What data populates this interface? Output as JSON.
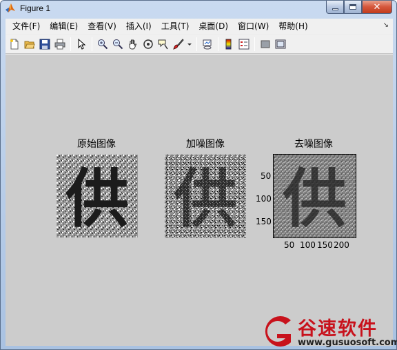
{
  "window": {
    "title": "Figure 1",
    "minimize_icon": "minimize-icon",
    "maximize_icon": "maximize-icon",
    "close_icon": "close-icon"
  },
  "menubar": {
    "items": [
      {
        "label": "文件(F)"
      },
      {
        "label": "编辑(E)"
      },
      {
        "label": "查看(V)"
      },
      {
        "label": "插入(I)"
      },
      {
        "label": "工具(T)"
      },
      {
        "label": "桌面(D)"
      },
      {
        "label": "窗口(W)"
      },
      {
        "label": "帮助(H)"
      }
    ],
    "overflow_icon": "dock-arrow-icon"
  },
  "toolbar": {
    "icons": [
      "new-figure-icon",
      "open-file-icon",
      "save-icon",
      "print-icon",
      "select-arrow-icon",
      "zoom-in-icon",
      "zoom-out-icon",
      "pan-hand-icon",
      "rotate-3d-icon",
      "data-cursor-icon",
      "brush-icon",
      "brush-dropdown-icon",
      "link-plot-icon",
      "colorbar-icon",
      "legend-icon",
      "hide-plot-tools-icon",
      "show-plot-tools-icon"
    ]
  },
  "axes": [
    {
      "title": "原始图像"
    },
    {
      "title": "加噪图像"
    },
    {
      "title": "去噪图像",
      "y_ticks": [
        "50",
        "100",
        "150"
      ],
      "x_ticks": [
        "50",
        "100",
        "150",
        "200"
      ]
    }
  ],
  "image_glyph": "供",
  "watermark": {
    "brand": "谷速软件",
    "url": "www.gusuosoft.com",
    "brand_color": "#c8121c"
  },
  "colors": {
    "figure_bg": "#cccccc",
    "glyph": "#1a1a1a"
  }
}
